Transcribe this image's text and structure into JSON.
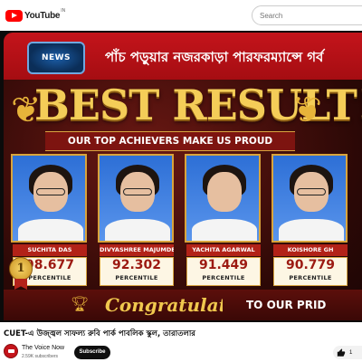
{
  "header": {
    "logo_text": "YouTube",
    "country_code": "IN",
    "search_placeholder": "Search"
  },
  "video": {
    "channel_logo_text": "NEWS",
    "headline": "পাঁচ পড়ুয়ার নজরকাড়া পারফরম্যান্সে গর্ব",
    "banner_title": "BEST RESULT!",
    "banner_tagline": "OUR TOP ACHIEVERS MAKE US PROUD",
    "rank_number": "1",
    "students": [
      {
        "name": "SUCHITA DAS",
        "score": "98.677",
        "unit": "PERCENTILE"
      },
      {
        "name": "DIVYASHREE MAJUMDER",
        "score": "92.302",
        "unit": "PERCENTILE"
      },
      {
        "name": "YACHITA AGARWAL",
        "score": "91.449",
        "unit": "PERCENTILE"
      },
      {
        "name": "KOISHORE GH",
        "score": "90.779",
        "unit": "PERCENTILE"
      }
    ],
    "congrats_text": "Congratulations",
    "congrats_suffix": "TO OUR PRID"
  },
  "info": {
    "title": "CUET-এ উজ্জ্বল সাফল্য রুবি পার্ক পাবলিক স্কুল, তারাতলার",
    "channel_name": "The Voice Now",
    "subscribers": "2.59K subscribers",
    "subscribe_label": "Subscribe",
    "like_count": "1"
  },
  "colors": {
    "brand_red": "#ff0000",
    "news_red": "#c4141b",
    "gold": "#f4cd58"
  },
  "icons": {
    "logo": "youtube-play-icon",
    "laurel": "laurel-wreath-icon",
    "trophy": "trophy-icon",
    "like": "thumbs-up-icon"
  }
}
